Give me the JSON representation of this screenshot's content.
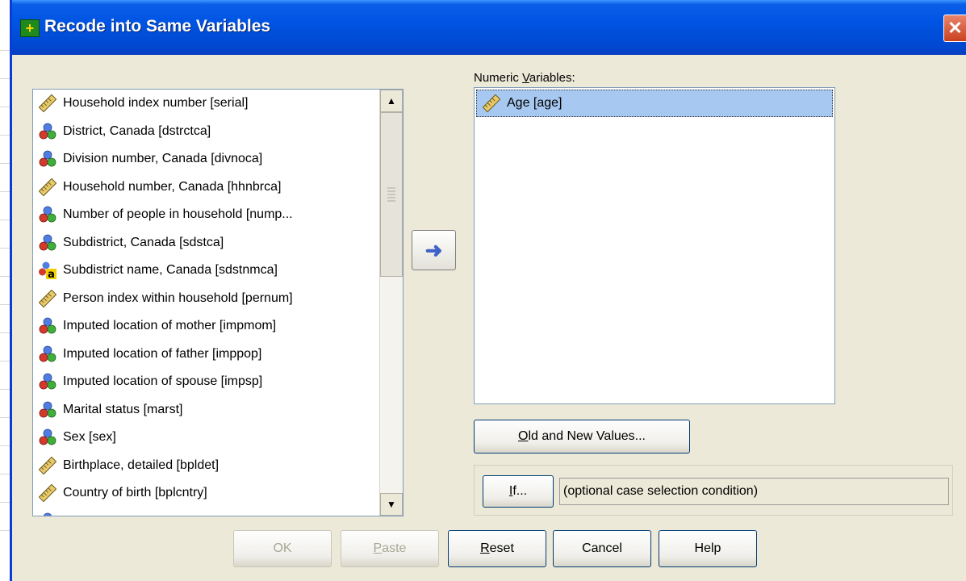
{
  "window": {
    "title": "Recode into Same Variables",
    "close_glyph": "✕"
  },
  "variable_list": {
    "items": [
      {
        "label": "Household index number [serial]",
        "icon": "scale-ruler-icon"
      },
      {
        "label": "District, Canada [dstrctca]",
        "icon": "nominal-balls-icon"
      },
      {
        "label": "Division number, Canada [divnoca]",
        "icon": "nominal-balls-icon"
      },
      {
        "label": "Household number, Canada [hhnbrca]",
        "icon": "scale-ruler-icon"
      },
      {
        "label": "Number of people in household [nump...",
        "icon": "nominal-balls-icon"
      },
      {
        "label": "Subdistrict, Canada [sdstca]",
        "icon": "nominal-balls-icon"
      },
      {
        "label": "Subdistrict name, Canada [sdstnmca]",
        "icon": "string-nominal-icon"
      },
      {
        "label": "Person index within household [pernum]",
        "icon": "scale-ruler-icon"
      },
      {
        "label": "Imputed location of mother [impmom]",
        "icon": "nominal-balls-icon"
      },
      {
        "label": "Imputed location of father [imppop]",
        "icon": "nominal-balls-icon"
      },
      {
        "label": "Imputed location of spouse [impsp]",
        "icon": "nominal-balls-icon"
      },
      {
        "label": "Marital status [marst]",
        "icon": "nominal-balls-icon"
      },
      {
        "label": "Sex [sex]",
        "icon": "nominal-balls-icon"
      },
      {
        "label": "Birthplace, detailed [bpldet]",
        "icon": "scale-ruler-icon"
      },
      {
        "label": "Country of birth [bplcntry]",
        "icon": "scale-ruler-icon"
      }
    ]
  },
  "move_button": {
    "glyph": "➜"
  },
  "numeric_variables": {
    "label_prefix": "Numeric ",
    "label_underlined": "V",
    "label_suffix": "ariables:",
    "items": [
      {
        "label": "Age [age]",
        "icon": "scale-ruler-icon"
      }
    ]
  },
  "old_new_button": {
    "underlined": "O",
    "rest": "ld and New Values..."
  },
  "if_button": {
    "underlined": "I",
    "rest": "f..."
  },
  "if_condition_text": "(optional case selection condition)",
  "footer": {
    "ok": "OK",
    "paste_u": "P",
    "paste_rest": "aste",
    "reset_u": "R",
    "reset_rest": "eset",
    "cancel": "Cancel",
    "help": "Help"
  }
}
